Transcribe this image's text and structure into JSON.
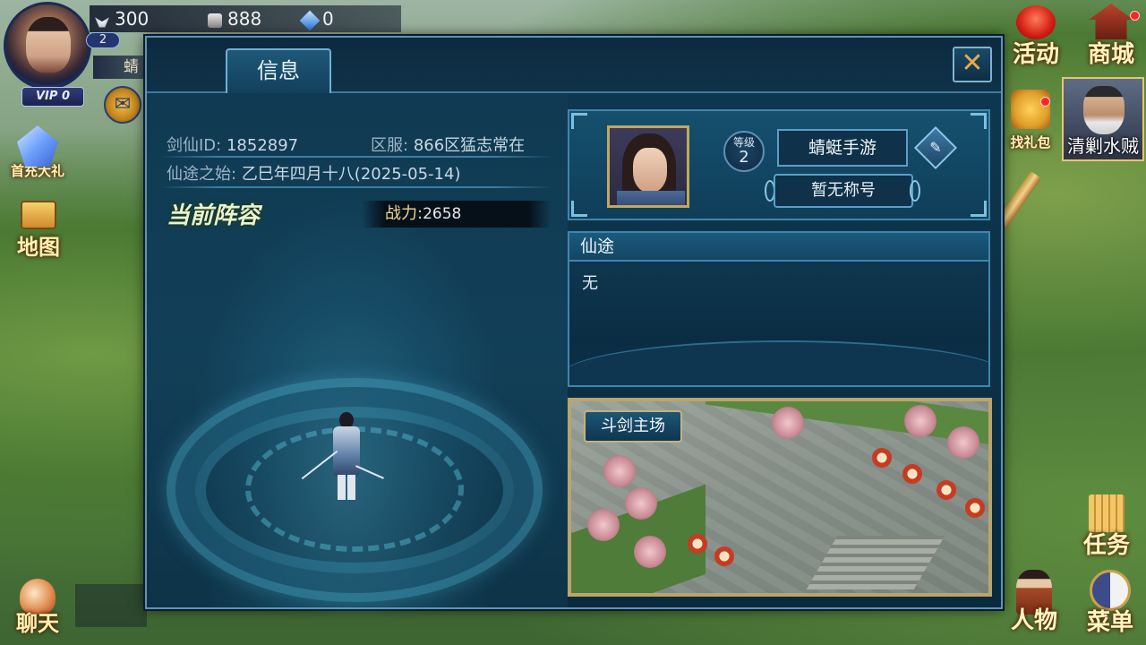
{
  "hud": {
    "resources": [
      {
        "name": "resource-1",
        "value": "300",
        "icon": "wing-icon"
      },
      {
        "name": "resource-2",
        "value": "888",
        "icon": "ingot-icon"
      },
      {
        "name": "resource-3",
        "value": "0",
        "icon": "gem-icon"
      }
    ],
    "level": "2",
    "name_fragment": "蜻",
    "vip": "VIP 0"
  },
  "left_menu": {
    "first_gift": "首充大礼",
    "map": "地图",
    "chat": "聊天"
  },
  "right_menu": {
    "activity": "活动",
    "shop": "商城",
    "gift_pack": "找礼包",
    "boss": "清剿水贼",
    "quest": "任务",
    "character": "人物",
    "menu": "菜单"
  },
  "panel": {
    "tab": "信息",
    "close_icon": "close-icon",
    "info": {
      "id_label": "剑仙ID:",
      "id_value": "1852897",
      "server_label": "区服:",
      "server_value": "866区猛志常在",
      "start_label": "仙途之始:",
      "start_value": "乙巳年四月十八(2025-05-14)"
    },
    "lineup_title": "当前阵容",
    "power_label": "战力:",
    "power_value": "2658",
    "profile": {
      "level_label": "等级",
      "level_value": "2",
      "name": "蜻蜓手游",
      "title": "暂无称号"
    },
    "path_heading": "仙途",
    "path_value": "无",
    "arena_label": "斗剑主场"
  },
  "colors": {
    "panel_bg": "#0f3850",
    "panel_border": "#5f94b5",
    "accent_gold": "#e6a94a",
    "power_text": "#f0d68a"
  }
}
